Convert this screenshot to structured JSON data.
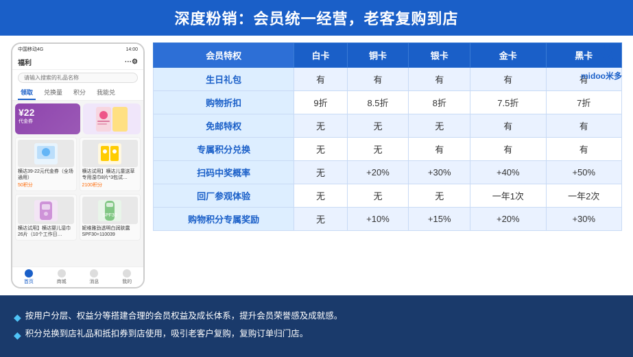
{
  "header": {
    "title": "深度粉销：会员统一经营，老客复购到店"
  },
  "logo": {
    "text": "midoo米多",
    "alt": "midoo logo"
  },
  "phone": {
    "status_bar": {
      "carrier": "中国移动4G",
      "time": "14:00",
      "battery": "■"
    },
    "nav_title": "福利",
    "search_placeholder": "请输入搜索的礼品名称",
    "tabs": [
      "领取",
      "兑换量",
      "积分",
      "我能兑"
    ],
    "active_tab": "领取",
    "coupon_amount": "¥22",
    "coupon_label": "代金券",
    "product1_title": "横达39-22元代金券（全场通用）",
    "product1_points": "50积分",
    "product2_title": "横达试用】横达儿童送草专用湿巾8片*3包试…",
    "product2_points": "2100积分",
    "product3_title": "横达试用】横达婴儿湿巾26片（10个工作日…",
    "product3_points": "",
    "product4_title": "妮维雅劲透明白润肤露SPF30+110039",
    "product4_points": "",
    "bottom_nav": [
      "首页",
      "商城",
      "消息",
      "我的"
    ],
    "active_nav": "首页"
  },
  "table": {
    "headers": [
      "会员特权",
      "白卡",
      "铜卡",
      "银卡",
      "金卡",
      "黑卡"
    ],
    "rows": [
      [
        "生日礼包",
        "有",
        "有",
        "有",
        "有",
        "有"
      ],
      [
        "购物折扣",
        "9折",
        "8.5折",
        "8折",
        "7.5折",
        "7折"
      ],
      [
        "免邮特权",
        "无",
        "无",
        "无",
        "有",
        "有"
      ],
      [
        "专属积分兑换",
        "无",
        "无",
        "有",
        "有",
        "有"
      ],
      [
        "扫码中奖概率",
        "无",
        "+20%",
        "+30%",
        "+40%",
        "+50%"
      ],
      [
        "回厂参观体验",
        "无",
        "无",
        "无",
        "一年1次",
        "一年2次"
      ],
      [
        "购物积分专属奖励",
        "无",
        "+10%",
        "+15%",
        "+20%",
        "+30%"
      ]
    ]
  },
  "footer": {
    "items": [
      "按用户分层、权益分等搭建合理的会员权益及成长体系，提升会员荣誉感及成就感。",
      "积分兑换到店礼品和抵扣券到店使用，吸引老客户复购，复购订单归门店。"
    ]
  }
}
